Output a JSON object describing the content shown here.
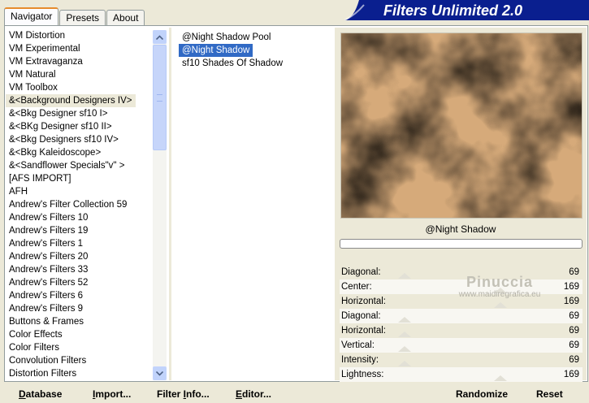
{
  "tabs": [
    {
      "label": "Navigator",
      "active": true
    },
    {
      "label": "Presets",
      "active": false
    },
    {
      "label": "About",
      "active": false
    }
  ],
  "banner": {
    "title": "Filters Unlimited 2.0",
    "bg": "#0a1f8f"
  },
  "categories": {
    "items": [
      "VM Distortion",
      "VM Experimental",
      "VM Extravaganza",
      "VM Natural",
      "VM Toolbox",
      "&<Background Designers IV>",
      "&<Bkg Designer sf10 I>",
      "&<BKg Designer sf10 II>",
      "&<Bkg Designers sf10 IV>",
      "&<Bkg Kaleidoscope>",
      "&<Sandflower Specials\"v\" >",
      "[AFS IMPORT]",
      "AFH",
      "Andrew's Filter Collection 59",
      "Andrew's Filters 10",
      "Andrew's Filters 19",
      "Andrew's Filters 1",
      "Andrew's Filters 20",
      "Andrew's Filters 33",
      "Andrew's Filters 52",
      "Andrew's Filters 6",
      "Andrew's Filters 9",
      "Buttons & Frames",
      "Color Effects",
      "Color Filters",
      "Convolution Filters",
      "Distortion Filters"
    ],
    "selected_index": 5
  },
  "filters": {
    "items": [
      "@Night Shadow Pool",
      "@Night Shadow",
      "sf10 Shades Of Shadow"
    ],
    "selected_index": 1,
    "selection_color": "#316ac5"
  },
  "preview": {
    "name": "@Night Shadow"
  },
  "params": [
    {
      "label": "Diagonal:",
      "value": "69"
    },
    {
      "label": "Center:",
      "value": "169"
    },
    {
      "label": "Horizontal:",
      "value": "169"
    },
    {
      "label": "Diagonal:",
      "value": "69"
    },
    {
      "label": "Horizontal:",
      "value": "69"
    },
    {
      "label": "Vertical:",
      "value": "69"
    },
    {
      "label": "Intensity:",
      "value": "69"
    },
    {
      "label": "Lightness:",
      "value": "169"
    }
  ],
  "watermark": {
    "name": "Pinuccia",
    "url": "www.maidiregrafica.eu"
  },
  "bottom_buttons": {
    "database": {
      "u": "D",
      "rest": "atabase"
    },
    "import": {
      "pre": "",
      "u": "I",
      "rest": "mport..."
    },
    "filter_info": {
      "pre": "Filter ",
      "u": "I",
      "rest": "nfo..."
    },
    "editor": {
      "pre": "",
      "u": "E",
      "rest": "ditor..."
    },
    "randomize": "Randomize",
    "reset": "Reset"
  }
}
